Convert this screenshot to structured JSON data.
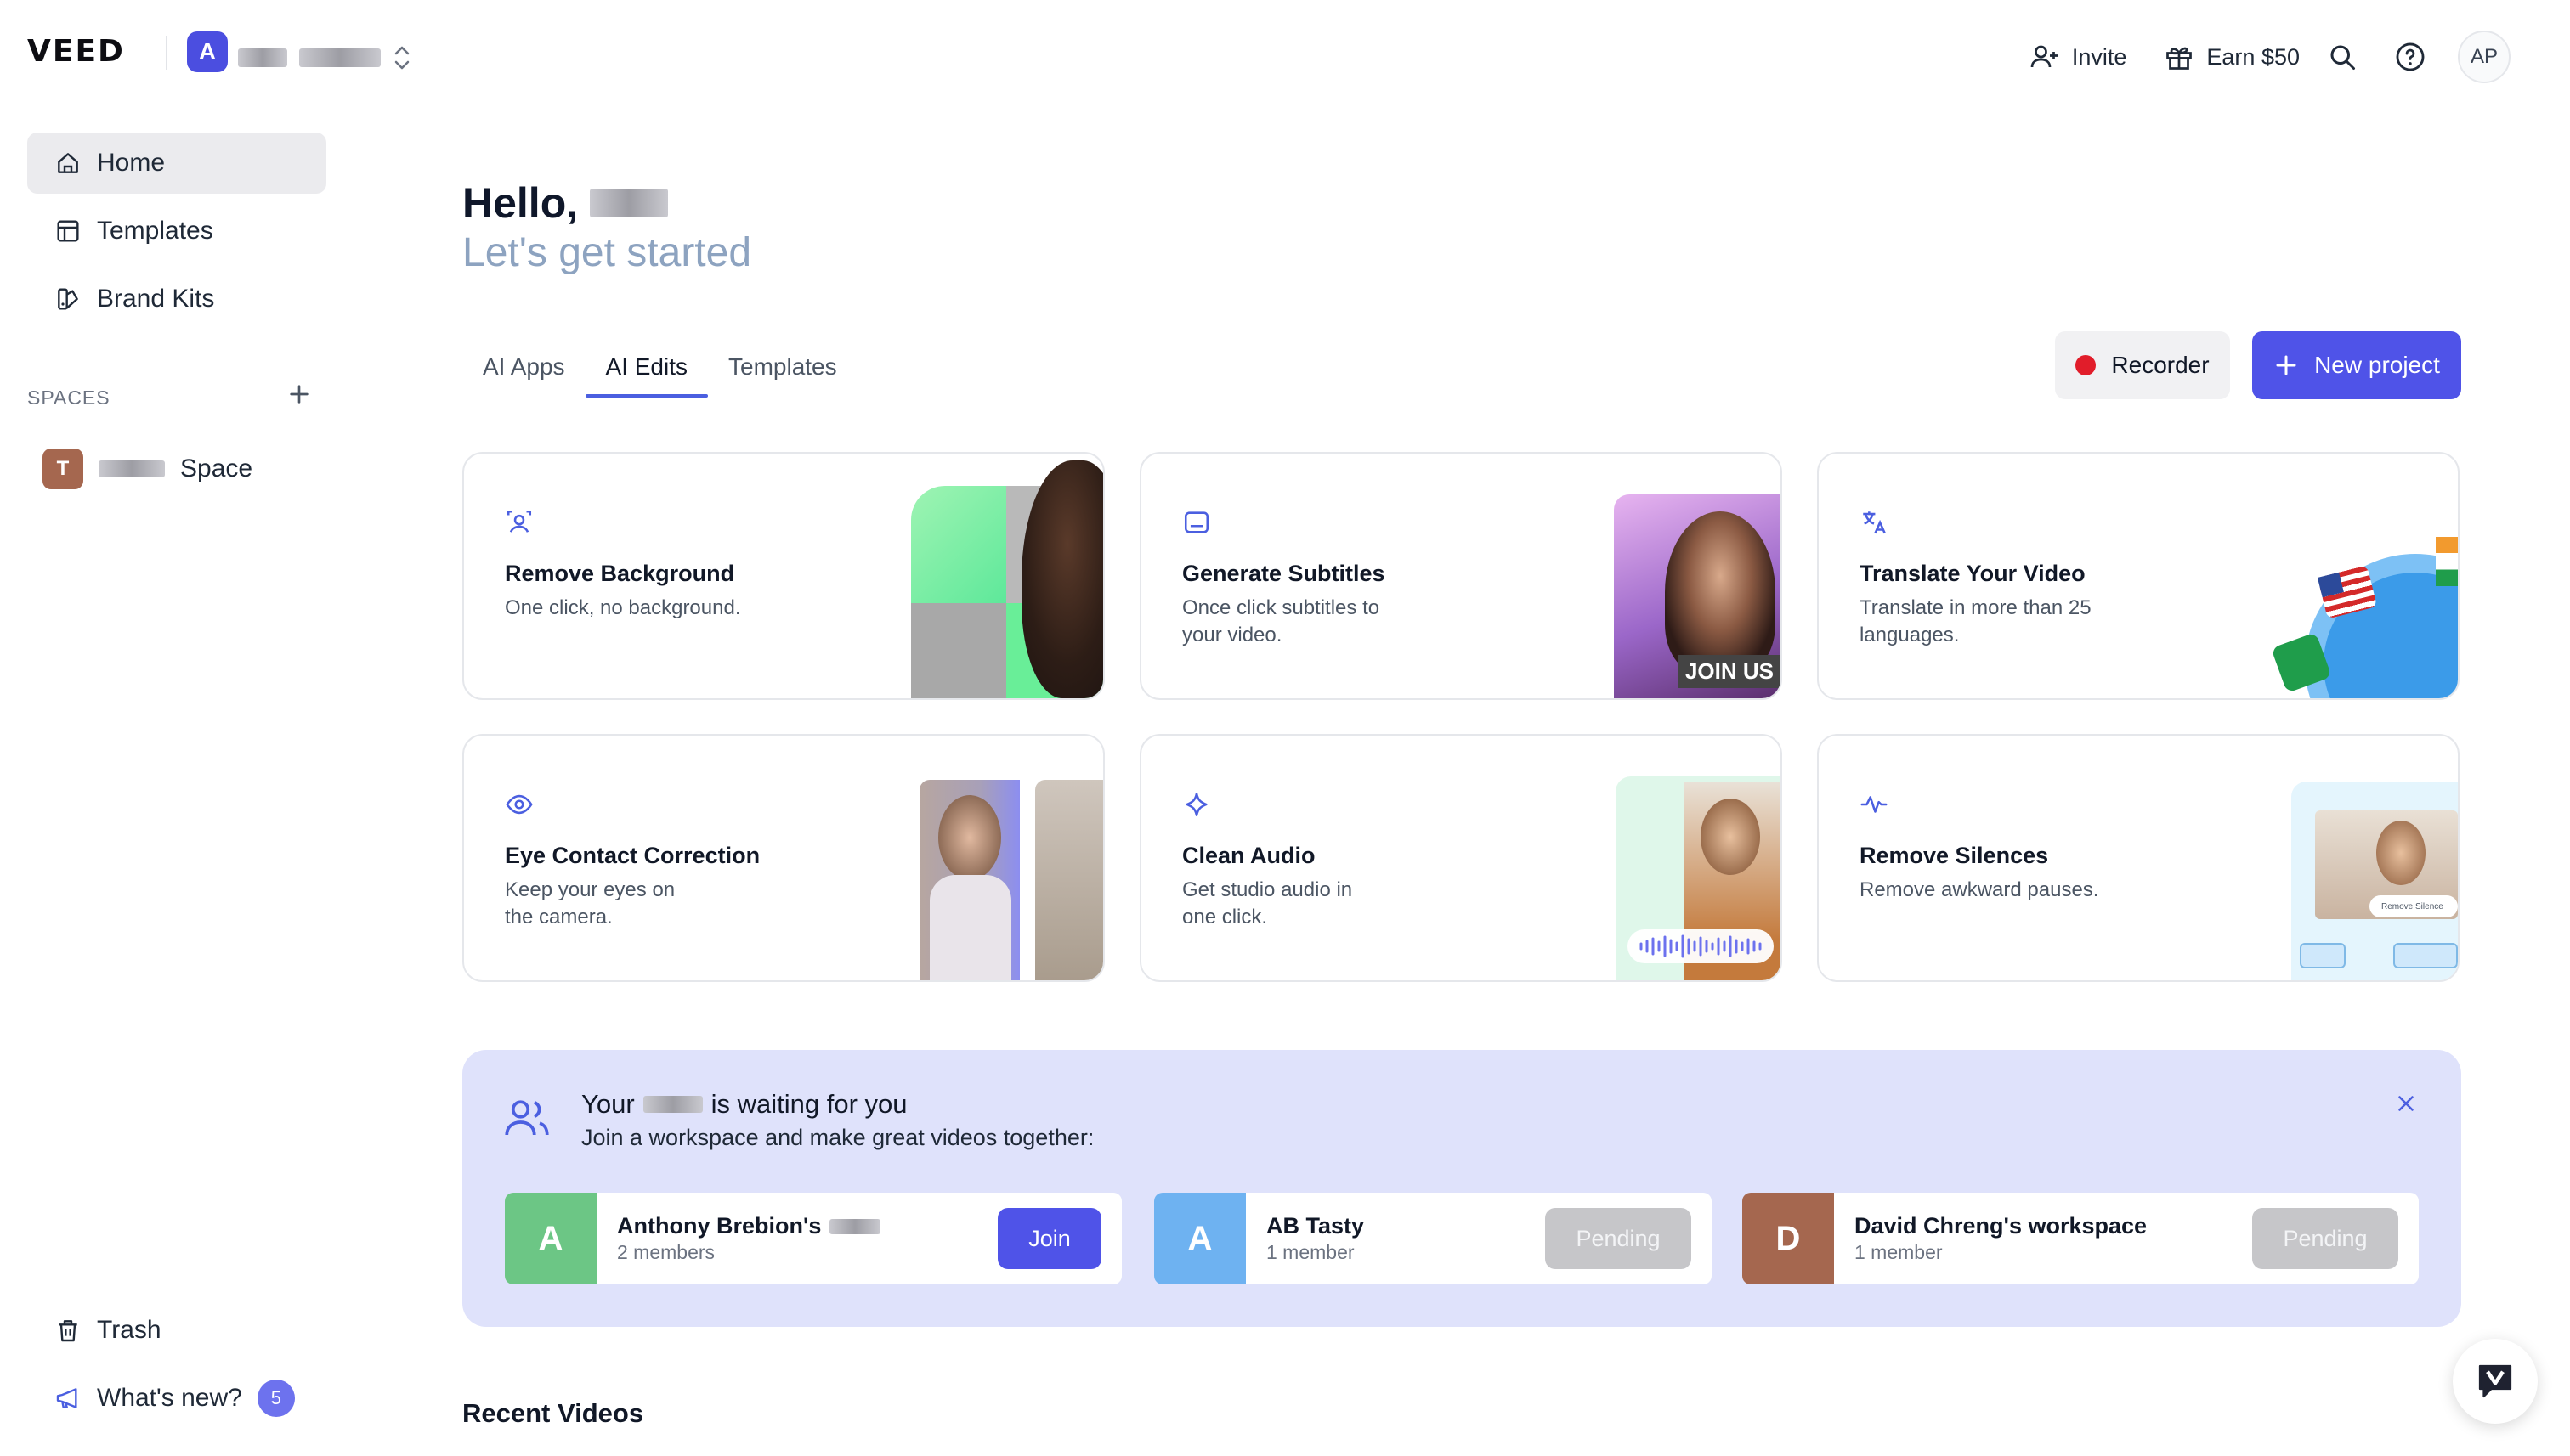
{
  "app": {
    "logo": "VEED",
    "workspace_letter": "A"
  },
  "topbar": {
    "invite_label": "Invite",
    "earn_label": "Earn $50",
    "user_initials": "AP"
  },
  "sidebar": {
    "items": [
      {
        "label": "Home",
        "icon": "home-icon"
      },
      {
        "label": "Templates",
        "icon": "templates-icon"
      },
      {
        "label": "Brand Kits",
        "icon": "brand-kits-icon"
      }
    ],
    "spaces_label": "SPACES",
    "space": {
      "letter": "T",
      "name": "Space"
    },
    "trash_label": "Trash",
    "whats_new_label": "What's new?",
    "whats_new_count": "5"
  },
  "main": {
    "greeting": "Hello,",
    "subtitle": "Let's get started",
    "tabs": [
      {
        "label": "AI Apps",
        "active": false
      },
      {
        "label": "AI Edits",
        "active": true
      },
      {
        "label": "Templates",
        "active": false
      }
    ],
    "recorder_label": "Recorder",
    "new_project_label": "New project",
    "cards": [
      {
        "title": "Remove Background",
        "desc": "One click, no background.",
        "icon": "person-icon"
      },
      {
        "title": "Generate Subtitles",
        "desc": "Once click subtitles to your video.",
        "icon": "subtitles-icon",
        "overlay": "JOIN US"
      },
      {
        "title": "Translate Your Video",
        "desc": "Translate in more than 25 languages.",
        "icon": "translate-icon"
      },
      {
        "title": "Eye Contact Correction",
        "desc": "Keep your eyes on the camera.",
        "icon": "eye-icon"
      },
      {
        "title": "Clean Audio",
        "desc": "Get studio audio in one click.",
        "icon": "sparkle-icon"
      },
      {
        "title": "Remove Silences",
        "desc": "Remove awkward pauses.",
        "icon": "waveform-icon",
        "overlay": "Remove Silence"
      }
    ],
    "banner": {
      "title_prefix": "Your",
      "title_suffix": "is waiting for you",
      "subtitle": "Join a workspace and make great videos together:",
      "workspaces": [
        {
          "letter": "A",
          "name": "Anthony Brebion's",
          "members": "2 members",
          "action": "Join",
          "color": "#6cc685"
        },
        {
          "letter": "A",
          "name": "AB Tasty",
          "members": "1 member",
          "action": "Pending",
          "color": "#6eb2f1"
        },
        {
          "letter": "D",
          "name": "David Chreng's workspace",
          "members": "1 member",
          "action": "Pending",
          "color": "#a5674f"
        }
      ]
    },
    "recent_videos_label": "Recent Videos"
  }
}
